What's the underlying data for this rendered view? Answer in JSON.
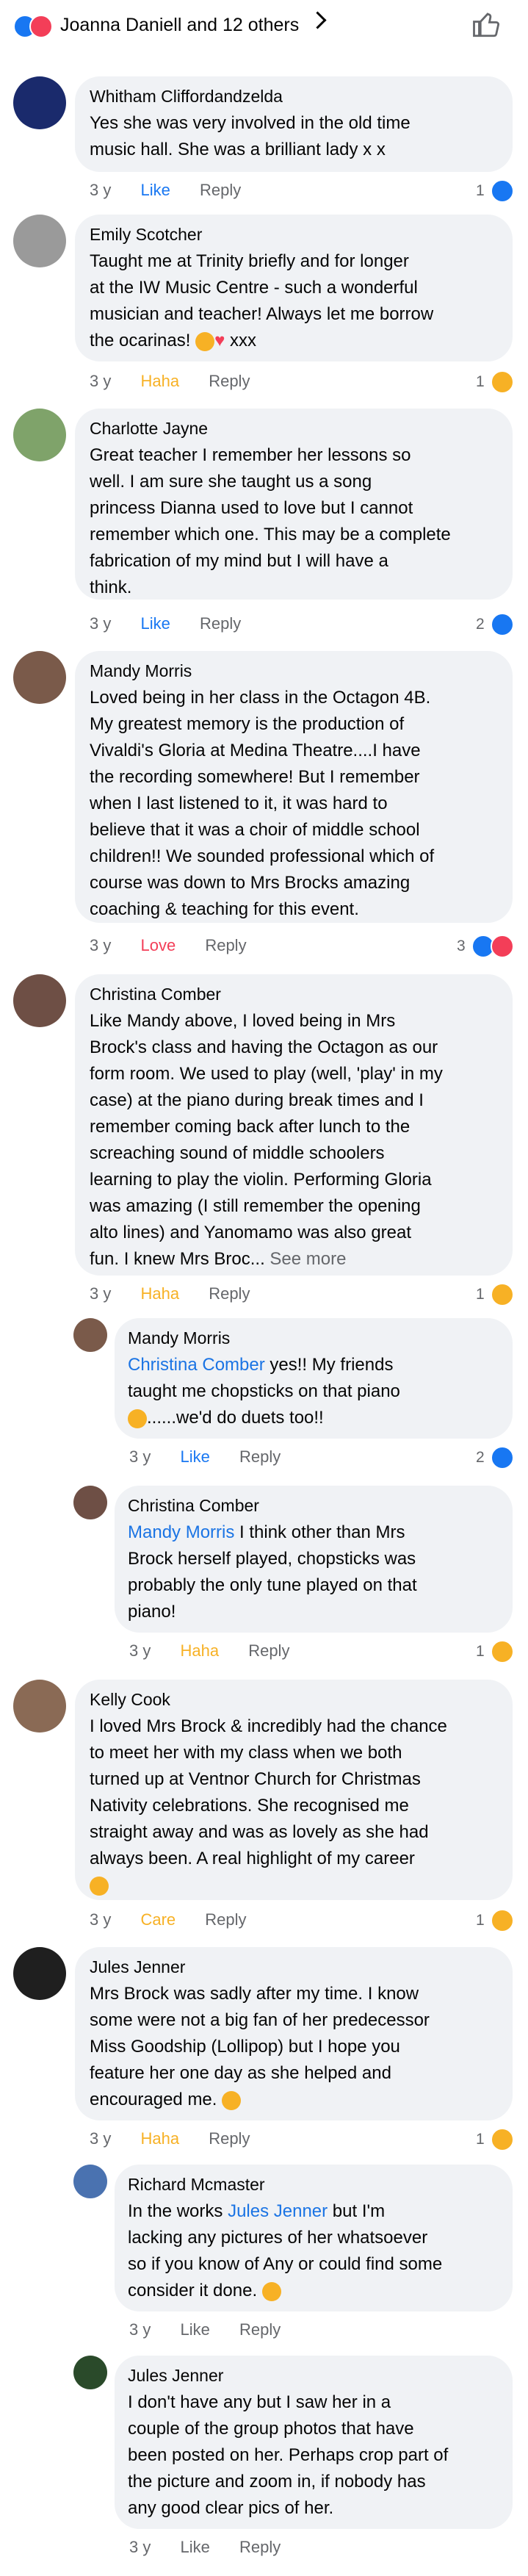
{
  "header": {
    "reactors": "Joanna Daniell and 12 others"
  },
  "comments": [
    {
      "author": "Whitham Cliffordandzelda",
      "lines": [
        "Yes she was very involved in the old time",
        "music hall. She was a brilliant lady x x"
      ],
      "time": "3 y",
      "reaction": "Like",
      "reply": "Reply",
      "count": "1"
    },
    {
      "author": "Emily Scotcher",
      "lines": [
        "Taught me at Trinity briefly and for longer",
        "at the IW Music Centre - such a wonderful",
        "musician and teacher! Always let me borrow",
        "the ocarinas!",
        " xxx"
      ],
      "time": "3 y",
      "reaction": "Haha",
      "reply": "Reply",
      "count": "1"
    },
    {
      "author": "Charlotte Jayne",
      "lines": [
        "Great teacher I remember her lessons so",
        "well. I am sure she taught us a song",
        "princess Dianna used to love but I cannot",
        "remember which one. This may be a complete",
        "fabrication of my mind but I will have a",
        "think."
      ],
      "time": "3 y",
      "reaction": "Like",
      "reply": "Reply",
      "count": "2"
    },
    {
      "author": "Mandy Morris",
      "lines": [
        "Loved being in her class in the Octagon 4B.",
        "My greatest memory is the production of",
        "Vivaldi's Gloria at Medina Theatre....I have",
        "the recording somewhere! But I remember",
        "when I last listened to it, it was hard to",
        "believe that it was a choir of middle school",
        "children!! We sounded professional which of",
        "course was down to Mrs Brocks amazing",
        "coaching & teaching for this event."
      ],
      "time": "3 y",
      "reaction": "Love",
      "reply": "Reply",
      "count": "3"
    },
    {
      "author": "Christina Comber",
      "lines": [
        "Like Mandy above, I loved being in Mrs",
        "Brock's class and having the Octagon as our",
        "form room. We used to play (well, 'play' in my",
        "case) at the piano during break times and I",
        "remember coming back after lunch to the",
        "screaching sound of middle schoolers",
        "learning to play the violin. Performing Gloria",
        "was amazing (I still remember the opening",
        "alto lines) and Yanomamo was also great",
        "fun. I knew Mrs Broc..."
      ],
      "see_more": "See more",
      "time": "3 y",
      "reaction": "Haha",
      "reply": "Reply",
      "count": "1"
    },
    {
      "author": "Mandy Morris",
      "mention": "Christina Comber",
      "lines": [
        " yes!! My friends",
        "taught me chopsticks on that piano",
        "......we'd do duets too!!"
      ],
      "time": "3 y",
      "reaction": "Like",
      "reply": "Reply",
      "count": "2"
    },
    {
      "author": "Christina Comber",
      "mention": "Mandy Morris",
      "lines": [
        " I think other than Mrs",
        "Brock herself played, chopsticks was",
        "probably the only tune played on that",
        "piano!"
      ],
      "time": "3 y",
      "reaction": "Haha",
      "reply": "Reply",
      "count": "1"
    },
    {
      "author": "Kelly Cook",
      "lines": [
        "I loved Mrs Brock & incredibly had the chance",
        "to meet her with my class when we both",
        "turned up at Ventnor Church for Christmas",
        "Nativity celebrations. She recognised me",
        "straight away and was as lovely as she had",
        "always been. A real highlight of my career"
      ],
      "time": "3 y",
      "reaction": "Care",
      "reply": "Reply",
      "count": "1"
    },
    {
      "author": "Jules Jenner",
      "lines": [
        "Mrs Brock was sadly after my time. I know",
        "some were not a big fan of her predecessor",
        "Miss Goodship (Lollipop) but I hope you",
        "feature her one day as she helped and",
        "encouraged me."
      ],
      "time": "3 y",
      "reaction": "Haha",
      "reply": "Reply",
      "count": "1"
    },
    {
      "author": "Richard Mcmaster",
      "prefix": "In the works ",
      "mention": "Jules Jenner",
      "lines": [
        " but I'm",
        "lacking any pictures of her whatsoever",
        "so if you know of Any or could find some",
        "consider it done."
      ],
      "time": "3 y",
      "reaction": "Like",
      "reply": "Reply"
    },
    {
      "author": "Jules Jenner",
      "lines": [
        "I don't have any but I saw her in a",
        "couple of the group photos that have",
        "been posted on her. Perhaps crop part of",
        "the picture and zoom in, if nobody has",
        "any good clear pics of her."
      ],
      "time": "3 y",
      "reaction": "Like",
      "reply": "Reply"
    }
  ]
}
